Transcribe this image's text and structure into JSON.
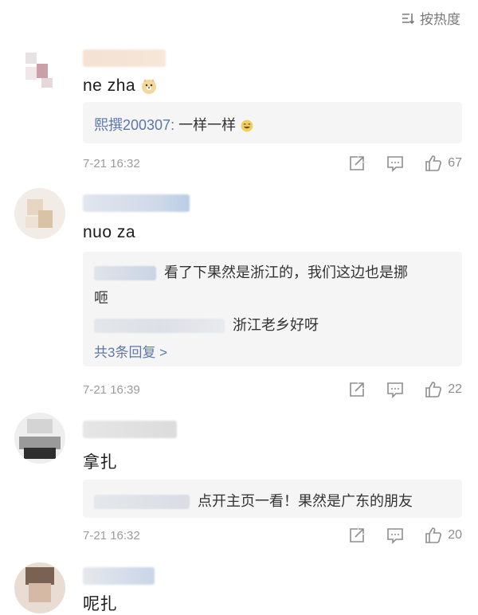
{
  "sort": {
    "label": "按热度"
  },
  "comments": [
    {
      "text": "ne zha",
      "reply": {
        "user": "熙撰200307",
        "separator": ": ",
        "text": "一样一样"
      },
      "time": "7-21 16:32",
      "likes": "67"
    },
    {
      "text": "nuo za",
      "replies": [
        {
          "text": "看了下果然是浙江的，我们这边也是挪"
        },
        {
          "text": "咂"
        },
        {
          "text": "浙江老乡好呀"
        }
      ],
      "more": "共3条回复 >",
      "time": "7-21 16:39",
      "likes": "22"
    },
    {
      "text": "拿扎",
      "reply": {
        "text": "点开主页一看！果然是广东的朋友"
      },
      "time": "7-21 16:32",
      "likes": "20"
    },
    {
      "text": "呢扎"
    }
  ],
  "colors": {
    "accent_link": "#5b77a8",
    "meta": "#9b9b9b",
    "reply_bg": "#f5f5f5"
  },
  "icons": [
    "sort-icon",
    "share-icon",
    "comment-icon",
    "like-icon"
  ]
}
